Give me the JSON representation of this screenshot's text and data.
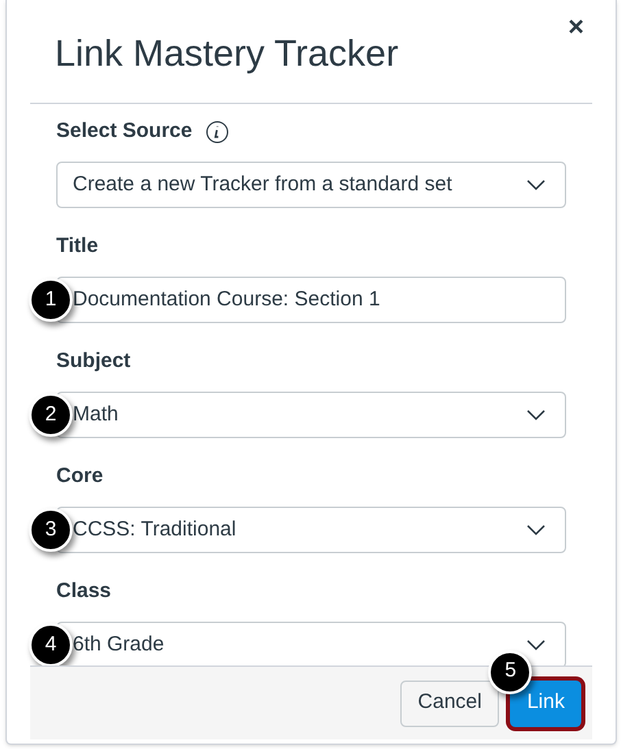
{
  "dialog": {
    "title": "Link Mastery Tracker",
    "close": "×"
  },
  "fields": [
    {
      "kind": "select",
      "label": "Select Source",
      "info": true,
      "value": "Create a new Tracker from a standard set"
    },
    {
      "kind": "text",
      "label": "Title",
      "info": false,
      "value": "Documentation Course: Section 1",
      "callout": "1"
    },
    {
      "kind": "select",
      "label": "Subject",
      "info": false,
      "value": "Math",
      "callout": "2"
    },
    {
      "kind": "select",
      "label": "Core",
      "info": false,
      "value": "CCSS: Traditional",
      "callout": "3"
    },
    {
      "kind": "select",
      "label": "Class",
      "info": false,
      "value": "6th Grade",
      "callout": "4"
    }
  ],
  "buttons": [
    {
      "kind": "secondary",
      "label": "Cancel",
      "highlighted": false
    },
    {
      "kind": "primary",
      "label": "Link",
      "highlighted": true,
      "callout": "5"
    }
  ]
}
